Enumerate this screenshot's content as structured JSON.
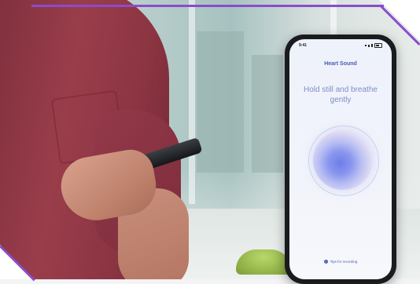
{
  "phone": {
    "status_time": "9:41",
    "title": "Heart Sound",
    "instruction": "Hold still and breathe gently",
    "footer_link": "Tips for recording",
    "footer_icon": "info-icon"
  },
  "colors": {
    "accent": "#8b4cc9",
    "title": "#4a5bb5",
    "instruction": "#7f8cc8",
    "shirt": "#8b3442"
  }
}
